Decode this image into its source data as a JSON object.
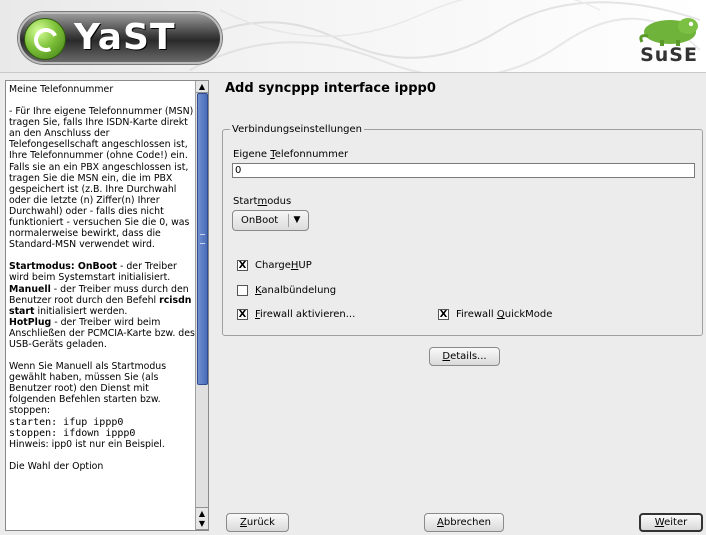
{
  "header": {
    "logo_text": "YaST",
    "brand_text": "SuSE"
  },
  "help": {
    "paragraphs": [
      "Meine Telefonnummer",
      "- Für Ihre eigene Telefonnummer (MSN) tragen Sie, falls Ihre ISDN-Karte direkt an den Anschluss der Telefongesellschaft angeschlossen ist, Ihre Telefonnummer (ohne Code!) ein. Falls sie an ein PBX angeschlossen ist, tragen Sie die MSN ein, die im PBX gespeichert ist (z.B. Ihre Durchwahl oder die letzte (n) Ziffer(n) Ihrer Durchwahl) oder - falls dies nicht funktioniert - versuchen Sie die 0, was normalerweise bewirkt, dass die Standard-MSN verwendet wird."
    ],
    "startmodus_bold": "Startmodus: OnBoot",
    "startmodus_rest": " - der Treiber wird beim Systemstart initialisiert.",
    "manuell_bold": "Manuell",
    "manuell_rest": " - der Treiber muss durch den Benutzer root durch den Befehl ",
    "rcisdn_bold": "rcisdn start",
    "rcisdn_rest": " initialisiert werden.",
    "hotplug_bold": "HotPlug",
    "hotplug_rest": " - der Treiber wird beim Anschließen der PCMCIA-Karte bzw. des USB-Geräts geladen.",
    "manual_note": "Wenn Sie Manuell als Startmodus gewählt haben, müssen Sie (als Benutzer root) den Dienst mit folgenden Befehlen starten bzw. stoppen:",
    "cmd_start": "starten: ifup ippp0",
    "cmd_stop": "stoppen: ifdown ippp0",
    "hint": "Hinweis: ipp0 ist nur ein Beispiel.",
    "last": "Die Wahl der Option"
  },
  "dialog": {
    "title": "Add syncppp interface ippp0",
    "group_title": "Verbindungseinstellungen",
    "phone_label_pre": "Eigene ",
    "phone_label_ul": "T",
    "phone_label_post": "elefonnummer",
    "phone_value": "0",
    "startmodus_label_pre": "Start",
    "startmodus_label_ul": "m",
    "startmodus_label_post": "odus",
    "startmodus_value": "OnBoot",
    "chargehup_pre": "Charge",
    "chargehup_ul": "H",
    "chargehup_post": "UP",
    "chargehup_checked": "X",
    "kanal_ul": "K",
    "kanal_post": "analbündelung",
    "kanal_checked": "",
    "firewall_ul": "F",
    "firewall_post": "irewall aktivieren...",
    "firewall_checked": "X",
    "quick_pre": "Firewall ",
    "quick_ul": "Q",
    "quick_post": "uickMode",
    "quick_checked": "X",
    "details_ul": "D",
    "details_post": "etails..."
  },
  "buttons": {
    "back_ul": "Z",
    "back_post": "urück",
    "cancel_ul": "A",
    "cancel_post": "bbrechen",
    "next_ul": "W",
    "next_post": "eiter"
  }
}
